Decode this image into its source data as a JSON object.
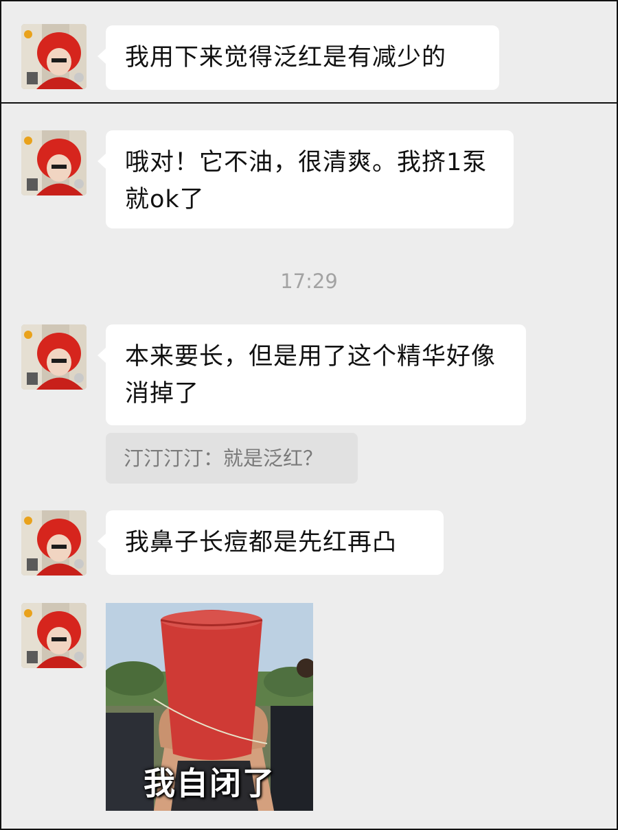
{
  "messages": [
    {
      "text": "我用下来觉得泛红是有减少的"
    },
    {
      "text": "哦对！它不油，很清爽。我挤1泵就ok了"
    },
    {
      "text": "本来要长，但是用了这个精华好像消掉了"
    },
    {
      "text": "我鼻子长痘都是先红再凸"
    }
  ],
  "timestamp": "17:29",
  "quote": {
    "text": "汀汀汀汀：就是泛红？"
  },
  "sticker": {
    "caption": "我自闭了"
  },
  "avatar": {
    "icon": "avatar-red-hood-photo"
  }
}
